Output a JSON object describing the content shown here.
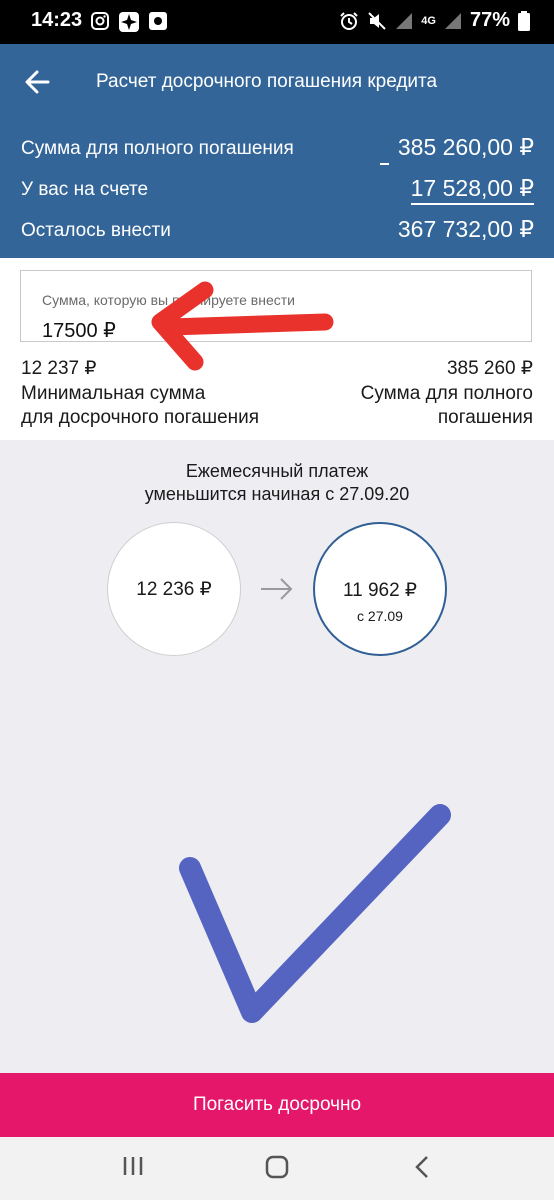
{
  "status_bar": {
    "time": "14:23",
    "network": "4G",
    "battery": "77%",
    "left_icons": [
      "instagram-icon",
      "app-icon",
      "square-app-icon"
    ],
    "right_icons": [
      "alarm-icon",
      "mute-icon",
      "signal-icon",
      "signal-4g-icon",
      "battery-icon"
    ]
  },
  "header": {
    "title": "Расчет досрочного погашения кредита",
    "rows": [
      {
        "label": "Сумма для полного погашения",
        "value": "385 260,00 ₽"
      },
      {
        "label": "У вас на счете",
        "value": "17 528,00 ₽"
      },
      {
        "label": "Осталось внести",
        "value": "367 732,00 ₽"
      }
    ]
  },
  "amount_input": {
    "label": "Сумма, которую вы планируете внести",
    "value": "17500 ₽"
  },
  "range": {
    "min_value": "12 237 ₽",
    "min_label_1": "Минимальная сумма",
    "min_label_2": "для досрочного погашения",
    "max_value": "385 260 ₽",
    "max_label_1": "Сумма для полного",
    "max_label_2": "погашения"
  },
  "payment": {
    "title_line1": "Ежемесячный платеж",
    "title_line2": "уменьшится начиная с 27.09.20",
    "old_amount": "12 236 ₽",
    "new_amount": "11 962 ₽",
    "new_date": "с 27.09"
  },
  "actions": {
    "pay_early": "Погасить досрочно"
  },
  "colors": {
    "header_bg": "#336599",
    "accent_button": "#e5176a",
    "annotation_arrow": "#e8322b",
    "annotation_check": "#5563c1"
  }
}
